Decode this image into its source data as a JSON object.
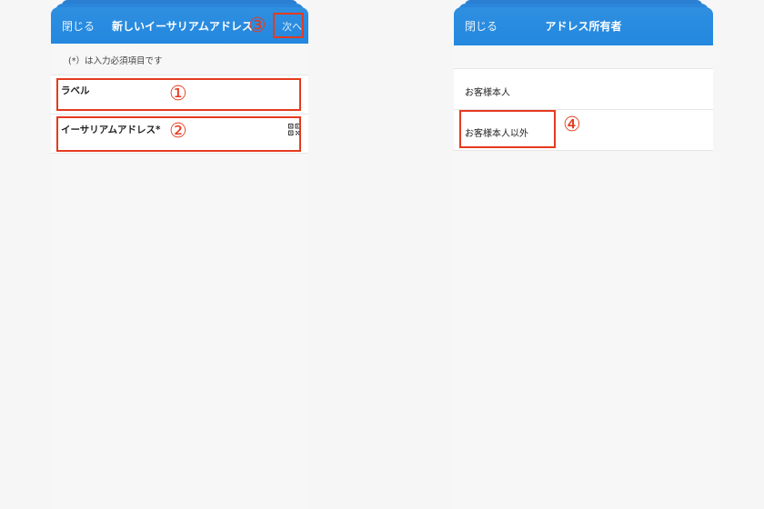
{
  "left_screen": {
    "nav": {
      "close_label": "閉じる",
      "title": "新しいイーサリアムアドレス",
      "next_label": "次へ"
    },
    "required_note": "(*）は入力必須項目です",
    "fields": [
      {
        "label": "ラベル"
      },
      {
        "label": "イーサリアムアドレス*",
        "icon": "qr-code-icon"
      }
    ]
  },
  "right_screen": {
    "nav": {
      "close_label": "閉じる",
      "title": "アドレス所有者"
    },
    "options": [
      {
        "label": "お客様本人"
      },
      {
        "label": "お客様本人以外"
      }
    ]
  },
  "annotations": {
    "color": "#e63a1f",
    "markers": [
      "①",
      "②",
      "③",
      "④"
    ]
  }
}
